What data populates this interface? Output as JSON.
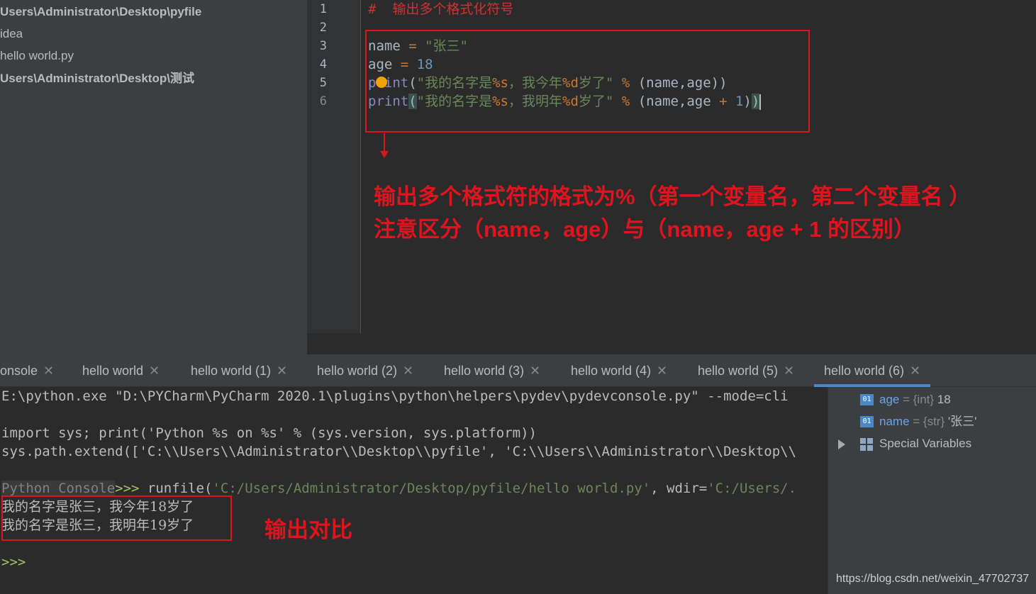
{
  "project_tree": [
    {
      "label": "Users\\Administrator\\Desktop\\pyfile",
      "bold": true
    },
    {
      "label": "idea",
      "bold": false
    },
    {
      "label": "hello world.py",
      "bold": false
    },
    {
      "label": "Users\\Administrator\\Desktop\\测试",
      "bold": true
    }
  ],
  "editor": {
    "line_numbers": [
      "1",
      "2",
      "3",
      "4",
      "5",
      "6"
    ],
    "line1_comment": "#  输出多个格式化符号",
    "line3": {
      "var": "name",
      "op": " = ",
      "str": "\"张三\""
    },
    "line4": {
      "var": "age",
      "op": " = ",
      "num": "18"
    },
    "line5": {
      "func": "print",
      "open": "(",
      "str_a": "\"我的名字是",
      "fmt1": "%s",
      "str_b": "，我今年",
      "fmt2": "%d",
      "str_c": "岁了\"",
      "op": " % ",
      "args": "(name,age))"
    },
    "line6": {
      "func": "print",
      "open": "(",
      "str_a": "\"我的名字是",
      "fmt1": "%s",
      "str_b": "，我明年",
      "fmt2": "%d",
      "str_c": "岁了\"",
      "op": " % ",
      "args_a": "(name,age ",
      "plus": "+",
      "num": " 1",
      "close_a": ")",
      "close_b": ")"
    }
  },
  "annotations": {
    "line1": "输出多个格式符的格式为%（第一个变量名，第二个变量名 ）",
    "line2": "注意区分（name，age）与（name，age + 1 的区别）",
    "console_note": "输出对比"
  },
  "tabs": [
    {
      "label": "onsole"
    },
    {
      "label": "hello world"
    },
    {
      "label": "hello world (1)"
    },
    {
      "label": "hello world (2)"
    },
    {
      "label": "hello world (3)"
    },
    {
      "label": "hello world (4)"
    },
    {
      "label": "hello world (5)"
    },
    {
      "label": "hello world (6)"
    }
  ],
  "tab_close_glyph": "✕",
  "console": {
    "cmd_line": "E:\\python.exe \"D:\\PYCharm\\PyCharm 2020.1\\plugins\\python\\helpers\\pydev\\pydevconsole.py\" --mode=cli",
    "import_line": "import sys; print('Python %s on %s' % (sys.version, sys.platform))",
    "path_line": "sys.path.extend(['C:\\\\Users\\\\Administrator\\\\Desktop\\\\pyfile', 'C:\\\\Users\\\\Administrator\\\\Desktop\\\\",
    "prompt_label": "Python Console",
    "prompt": ">>>",
    "runfile_a": " runfile(",
    "runfile_path": "'C:/Users/Administrator/Desktop/pyfile/hello world.py'",
    "runfile_b": ", wdir=",
    "runfile_wdir": "'C:/Users/.",
    "output1": "我的名字是张三，我今年18岁了",
    "output2": "我的名字是张三，我明年19岁了",
    "final_prompt": ">>>"
  },
  "variables": [
    {
      "badge": "01",
      "name": "age",
      "eq": " = ",
      "type": "{int} ",
      "value": "18"
    },
    {
      "badge": "01",
      "name": "name",
      "eq": " = ",
      "type": "{str} ",
      "value": "'张三'"
    }
  ],
  "special_variables": "Special Variables",
  "watermark": "https://blog.csdn.net/weixin_47702737"
}
